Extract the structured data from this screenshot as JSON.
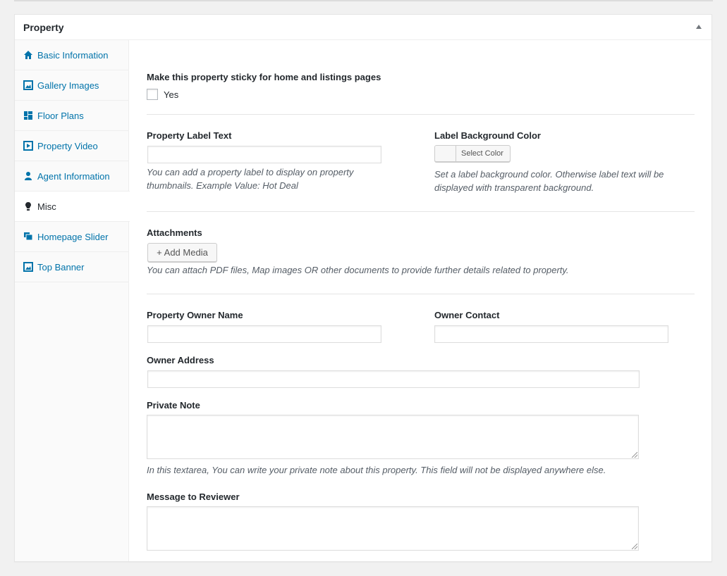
{
  "metabox": {
    "title": "Property"
  },
  "tabs": [
    {
      "label": "Basic Information",
      "icon": "home-icon"
    },
    {
      "label": "Gallery Images",
      "icon": "gallery-icon"
    },
    {
      "label": "Floor Plans",
      "icon": "floor-plan-icon"
    },
    {
      "label": "Property Video",
      "icon": "video-icon"
    },
    {
      "label": "Agent Information",
      "icon": "agent-icon"
    },
    {
      "label": "Misc",
      "icon": "lightbulb-icon",
      "active": true
    },
    {
      "label": "Homepage Slider",
      "icon": "slider-icon"
    },
    {
      "label": "Top Banner",
      "icon": "banner-icon"
    }
  ],
  "sticky": {
    "label": "Make this property sticky for home and listings pages",
    "option": "Yes",
    "checked": false
  },
  "label_text": {
    "label": "Property Label Text",
    "value": "",
    "desc_line1": "You can add a property label to display on property",
    "desc_line2": "thumbnails. Example Value: Hot Deal"
  },
  "label_bg": {
    "label": "Label Background Color",
    "button": "Select Color",
    "desc_line1": "Set a label background color. Otherwise label text will be",
    "desc_line2": "displayed with transparent background."
  },
  "attachments": {
    "label": "Attachments",
    "button": "+ Add Media",
    "desc": "You can attach PDF files, Map images OR other documents to provide further details related to property."
  },
  "owner_name": {
    "label": "Property Owner Name",
    "value": ""
  },
  "owner_contact": {
    "label": "Owner Contact",
    "value": ""
  },
  "owner_address": {
    "label": "Owner Address",
    "value": ""
  },
  "private_note": {
    "label": "Private Note",
    "value": "",
    "desc": "In this textarea, You can write your private note about this property. This field will not be displayed anywhere else."
  },
  "reviewer_message": {
    "label": "Message to Reviewer",
    "value": ""
  },
  "colors": {
    "link": "#0073aa",
    "text": "#23282d",
    "desc": "#555d66"
  }
}
